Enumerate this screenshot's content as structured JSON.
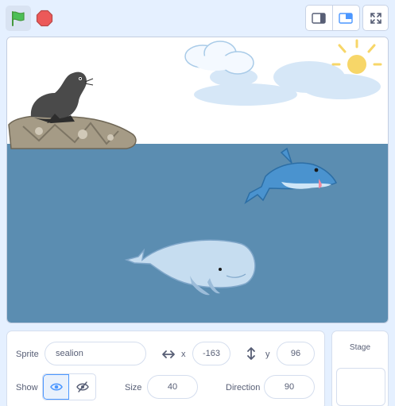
{
  "colors": {
    "accent": "#4c97ff",
    "sky": "#ffffff",
    "water": "#5b8db1",
    "flag": "#4cbf56",
    "stop": "#ec5959"
  },
  "toolbar": {
    "flag_icon": "green-flag-icon",
    "stop_icon": "stop-icon",
    "small_stage_icon": "small-stage-icon",
    "large_stage_icon": "large-stage-icon",
    "fullscreen_icon": "fullscreen-icon"
  },
  "sprite_info": {
    "sprite_label": "Sprite",
    "sprite_name": "sealion",
    "x_label": "x",
    "x_value": "-163",
    "y_label": "y",
    "y_value": "96",
    "show_label": "Show",
    "size_label": "Size",
    "size_value": "40",
    "direction_label": "Direction",
    "direction_value": "90"
  },
  "stage_panel": {
    "title": "Stage"
  }
}
